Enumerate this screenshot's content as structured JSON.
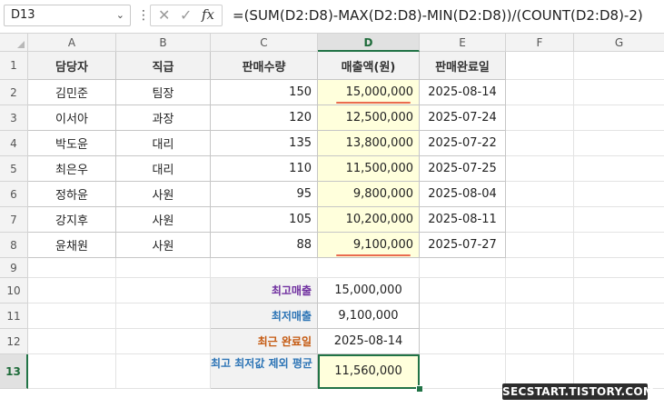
{
  "formula_bar": {
    "name_box": "D13",
    "formula": "=(SUM(D2:D8)-MAX(D2:D8)-MIN(D2:D8))/(COUNT(D2:D8)-2)"
  },
  "columns": [
    "A",
    "B",
    "C",
    "D",
    "E",
    "F",
    "G"
  ],
  "rows": [
    "1",
    "2",
    "3",
    "4",
    "5",
    "6",
    "7",
    "8",
    "9",
    "10",
    "11",
    "12",
    "13"
  ],
  "table": {
    "headers": [
      "담당자",
      "직급",
      "판매수량",
      "매출액(원)",
      "판매완료일"
    ],
    "rows": [
      [
        "김민준",
        "팀장",
        "150",
        "15,000,000",
        "2025-08-14"
      ],
      [
        "이서아",
        "과장",
        "120",
        "12,500,000",
        "2025-07-24"
      ],
      [
        "박도윤",
        "대리",
        "135",
        "13,800,000",
        "2025-07-22"
      ],
      [
        "최은우",
        "대리",
        "110",
        "11,500,000",
        "2025-07-25"
      ],
      [
        "정하윤",
        "사원",
        "95",
        "9,800,000",
        "2025-08-04"
      ],
      [
        "강지후",
        "사원",
        "105",
        "10,200,000",
        "2025-08-11"
      ],
      [
        "윤채원",
        "사원",
        "88",
        "9,100,000",
        "2025-07-27"
      ]
    ]
  },
  "summary": [
    {
      "label": "최고매출",
      "value": "15,000,000"
    },
    {
      "label": "최저매출",
      "value": "9,100,000"
    },
    {
      "label": "최근 완료일",
      "value": "2025-08-14"
    },
    {
      "label": "최고 최저값 제외 평균",
      "value": "11,560,000"
    }
  ],
  "watermark": "SECSTART.TISTORY.COM",
  "colors": {
    "accent_green": "#217346",
    "highlight_yellow": "#ffffdc",
    "underline": "#ea6b4f",
    "label_purple": "#7030a0",
    "label_blue": "#2e75b6",
    "label_orange": "#c55a11"
  }
}
